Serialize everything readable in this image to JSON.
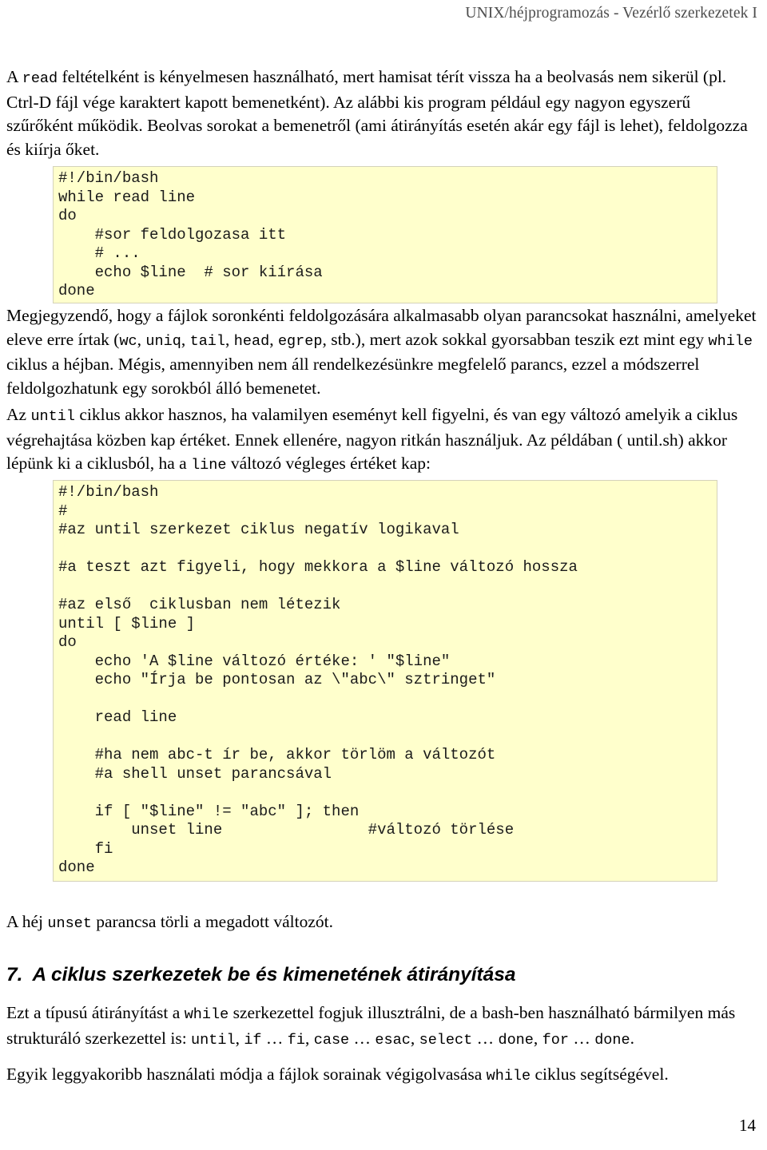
{
  "document": {
    "running_header": "UNIX/héjprogramozás - Vezérlő szerkezetek I",
    "page_number": "14"
  },
  "paragraphs": {
    "intro": {
      "part1": "A ",
      "code1": "read",
      "part2": " feltételként is kényelmesen használható, mert hamisat térít vissza ha a beolvasás nem sikerül (pl.  Ctrl-D fájl vége karaktert kapott bemenetként). Az alábbi kis program például egy nagyon egyszerű szűrőként működik. Beolvas sorokat a bemenetről (ami átirányítás esetén akár egy fájl is lehet), feldolgozza és kiírja őket."
    },
    "after_code1": {
      "p1": "Megjegyzendő, hogy a fájlok soronkénti feldolgozására alkalmasabb olyan parancsokat használni, amelyeket eleve erre írtak (",
      "c_wc": "wc",
      "sep1": ", ",
      "c_uniq": "uniq",
      "sep2": ", ",
      "c_tail": "tail",
      "sep3": ", ",
      "c_head": "head",
      "sep4": ", ",
      "c_egrep": "egrep",
      "sep5": ", stb.), mert azok sokkal gyorsabban teszik ezt mint egy ",
      "c_while": "while",
      "p2": " ciklus a héjban. Mégis, amennyiben nem áll rendelkezésünkre megfelelő parancs, ezzel a módszerrel feldolgozhatunk egy sorokból álló bemenetet."
    },
    "until_intro": {
      "p1": "Az ",
      "c_until": "until",
      "p2": " ciklus akkor hasznos, ha valamilyen eseményt kell figyelni, és van egy változó amelyik a ciklus végrehajtása közben kap értéket. Ennek ellenére, nagyon ritkán használjuk. Az példában ( until.sh) akkor lépünk ki a ciklusból, ha a ",
      "c_line": "line",
      "p3": " változó végleges értéket kap:"
    },
    "unset_note": {
      "p1": "A héj ",
      "c_unset": "unset",
      "p2": " parancsa törli a megadott változót."
    },
    "tail1": {
      "p1": "Ezt a típusú átirányítást a ",
      "c_while": "while",
      "p2": " szerkezettel fogjuk illusztrálni, de a bash-ben használható bármilyen más strukturáló szerkezettel is: ",
      "c_until": "until",
      "s1": ", ",
      "c_if": "if",
      "s2": " … ",
      "c_fi": "fi",
      "s3": ", ",
      "c_case": "case",
      "s4": " … ",
      "c_esac": "esac",
      "s5": ", ",
      "c_select": "select",
      "s6": " … ",
      "c_done": "done",
      "s7": ", ",
      "c_for": "for",
      "s8": " … ",
      "c_done2": "done",
      "s9": "."
    },
    "tail2": {
      "p1": "Egyik leggyakoribb használati módja a fájlok sorainak végigolvasása ",
      "c_while": "while",
      "p2": " ciklus segítségével."
    }
  },
  "headings": {
    "section7_number": "7.",
    "section7_title": "A ciklus szerkezetek be és kimenetének átirányítása"
  },
  "code_blocks": {
    "block1": "#!/bin/bash\nwhile read line\ndo\n    #sor feldolgozasa itt\n    # ...\n    echo $line  # sor kiírása\ndone",
    "block2": "#!/bin/bash\n#\n#az until szerkezet ciklus negatív logikaval\n\n#a teszt azt figyeli, hogy mekkora a $line változó hossza\n\n#az első  ciklusban nem létezik\nuntil [ $line ]\ndo\n    echo 'A $line változó értéke: ' \"$line\"\n    echo \"Írja be pontosan az \\\"abc\\\" sztringet\"\n\n    read line\n\n    #ha nem abc-t ír be, akkor törlöm a változót\n    #a shell unset parancsával\n\n    if [ \"$line\" != \"abc\" ]; then\n        unset line                #változó törlése\n    fi\ndone"
  },
  "colors": {
    "code_background": "#ffffcc",
    "code_border": "#d4d2ba",
    "header_text": "#4d4d4d",
    "body_text": "#000000"
  }
}
